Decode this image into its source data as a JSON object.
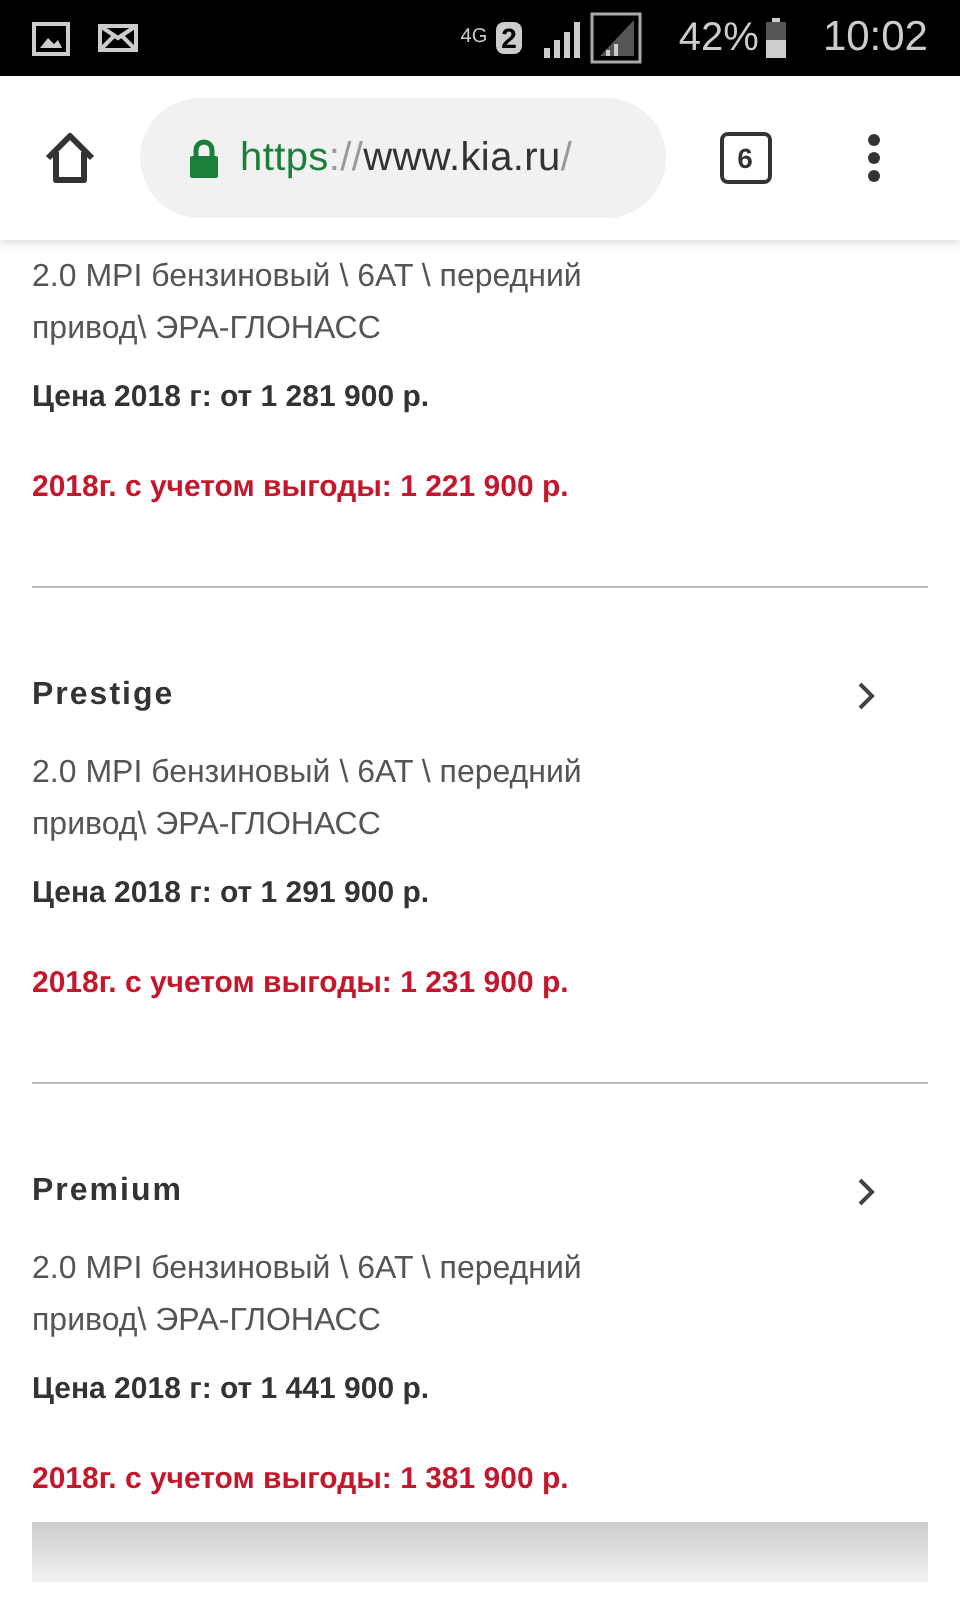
{
  "status_bar": {
    "network": "4G",
    "sim": "2",
    "battery_percent": "42%",
    "time": "10:02"
  },
  "browser": {
    "url": {
      "scheme": "https",
      "separator": "://",
      "host": "www.kia.ru",
      "path": "/"
    },
    "tab_count": "6"
  },
  "trims": [
    {
      "description": "2.0 MPI бензиновый \\ 6AT \\ передний привод\\ ЭРА-ГЛОНАСС",
      "price": "Цена 2018 г: от 1 281 900 р.",
      "discount_price": "2018г. с учетом выгоды: 1 221 900 р."
    },
    {
      "title": "Prestige",
      "description": "2.0 MPI бензиновый \\ 6AT \\ передний привод\\ ЭРА-ГЛОНАСС",
      "price": "Цена 2018 г: от 1 291 900 р.",
      "discount_price": "2018г. с учетом выгоды: 1 231 900 р."
    },
    {
      "title": "Premium",
      "description": "2.0 MPI бензиновый \\ 6AT \\ передний привод\\ ЭРА-ГЛОНАСС",
      "price": "Цена 2018 г: от 1 441 900 р.",
      "discount_price": "2018г. с учетом выгоды: 1 381 900 р."
    }
  ]
}
